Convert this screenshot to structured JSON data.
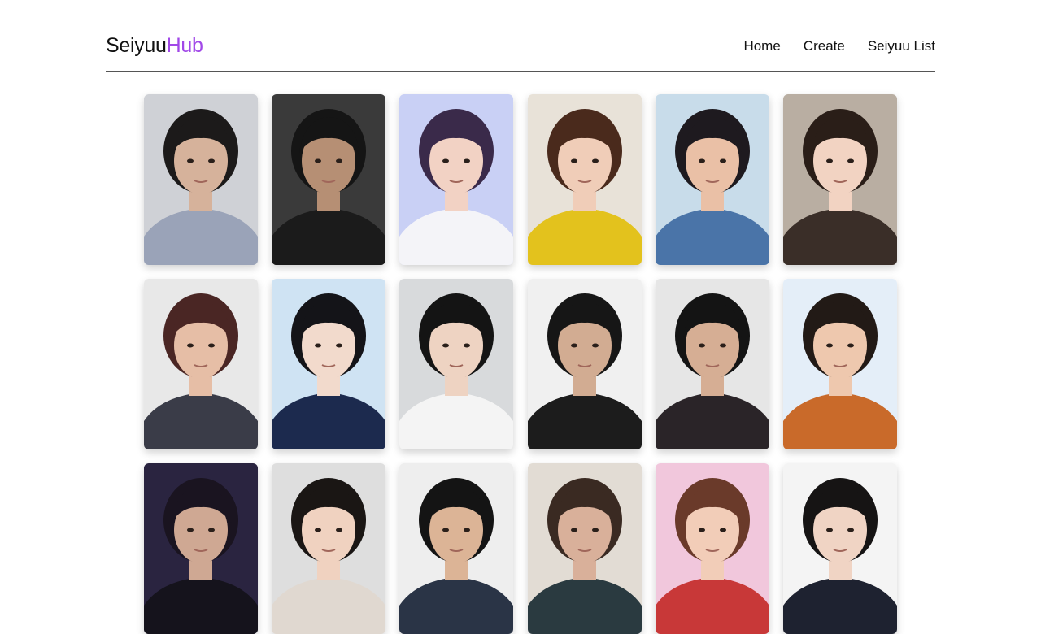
{
  "header": {
    "logo_main": "Seiyuu",
    "logo_accent": "Hub",
    "nav": [
      "Home",
      "Create",
      "Seiyuu List"
    ]
  },
  "colors": {
    "accent": "#a148e8"
  },
  "cards": [
    {
      "bg": "#cfd1d6",
      "hair": "#1c1a1a",
      "skin": "#d6b29b",
      "shirt": "#9aa3b8"
    },
    {
      "bg": "#3a3a3a",
      "hair": "#151515",
      "skin": "#b68f74",
      "shirt": "#1b1b1b"
    },
    {
      "bg": "#c9d0f5",
      "hair": "#3a2a4a",
      "skin": "#f2d2c4",
      "shirt": "#f4f4f8"
    },
    {
      "bg": "#e8e2d8",
      "hair": "#4a2a1c",
      "skin": "#f0cdb8",
      "shirt": "#e3c21d"
    },
    {
      "bg": "#c8dcea",
      "hair": "#1e1a1f",
      "skin": "#eac0a6",
      "shirt": "#4a74a8"
    },
    {
      "bg": "#b9aea2",
      "hair": "#2a1e18",
      "skin": "#f2d3c2",
      "shirt": "#3a2e28"
    },
    {
      "bg": "#e8e8e8",
      "hair": "#4a2624",
      "skin": "#e6bea6",
      "shirt": "#3a3c48"
    },
    {
      "bg": "#cfe3f3",
      "hair": "#141418",
      "skin": "#f2dacc",
      "shirt": "#1c2a4e"
    },
    {
      "bg": "#d8dadc",
      "hair": "#141414",
      "skin": "#eed3c2",
      "shirt": "#f4f4f4"
    },
    {
      "bg": "#f0f0f0",
      "hair": "#161616",
      "skin": "#d2ac92",
      "shirt": "#1c1c1c"
    },
    {
      "bg": "#e6e6e6",
      "hair": "#141414",
      "skin": "#d6ae94",
      "shirt": "#2a2428"
    },
    {
      "bg": "#e4eef8",
      "hair": "#221a16",
      "skin": "#eec8ae",
      "shirt": "#c96a2a"
    },
    {
      "bg": "#2a2440",
      "hair": "#1a1420",
      "skin": "#cfa893",
      "shirt": "#15131c"
    },
    {
      "bg": "#dedede",
      "hair": "#1a1614",
      "skin": "#f0d2c0",
      "shirt": "#e0d8d0"
    },
    {
      "bg": "#eeeeee",
      "hair": "#141414",
      "skin": "#dcb496",
      "shirt": "#2a3446"
    },
    {
      "bg": "#e2dcd4",
      "hair": "#3a2a22",
      "skin": "#d9b09a",
      "shirt": "#2a3a40"
    },
    {
      "bg": "#f1c7dc",
      "hair": "#6a3a2a",
      "skin": "#f2cdb8",
      "shirt": "#c83838"
    },
    {
      "bg": "#f4f4f4",
      "hair": "#161414",
      "skin": "#f0d4c4",
      "shirt": "#1e2230"
    }
  ]
}
